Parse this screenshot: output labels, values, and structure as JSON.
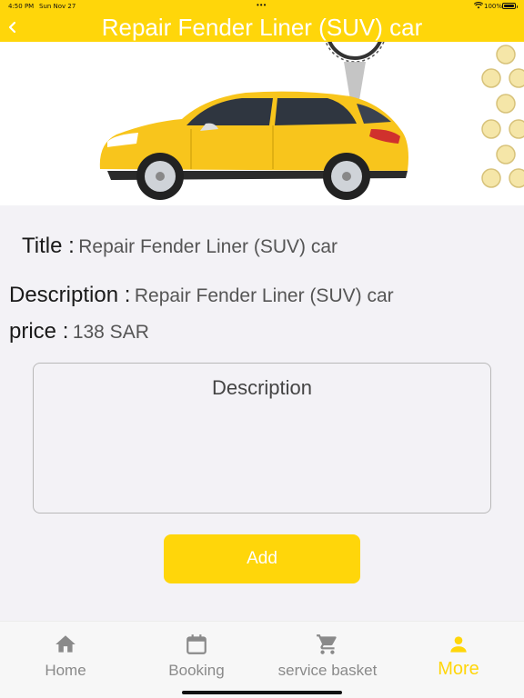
{
  "status_bar": {
    "time": "4:50 PM",
    "date": "Sun Nov 27",
    "battery": "100%"
  },
  "header": {
    "title": "Repair Fender Liner (SUV) car",
    "back_icon": "chevron-left-icon"
  },
  "service": {
    "title_label": "Title :",
    "title_value": "Repair Fender Liner (SUV) car",
    "description_label": "Description :",
    "description_value": "Repair Fender Liner (SUV) car",
    "price_label": "price :",
    "price_value": "138 SAR"
  },
  "description_input": {
    "placeholder": "Description",
    "value": ""
  },
  "add_button": {
    "label": "Add"
  },
  "tabs": [
    {
      "label": "Home",
      "icon": "home-icon",
      "active": false
    },
    {
      "label": "Booking",
      "icon": "calendar-icon",
      "active": false
    },
    {
      "label": "service basket",
      "icon": "cart-icon",
      "active": false
    },
    {
      "label": "More",
      "icon": "person-icon",
      "active": true
    }
  ],
  "colors": {
    "brand_yellow": "#ffd60a",
    "inactive_tab": "#8a8a8a",
    "background": "#f3f2f6"
  }
}
